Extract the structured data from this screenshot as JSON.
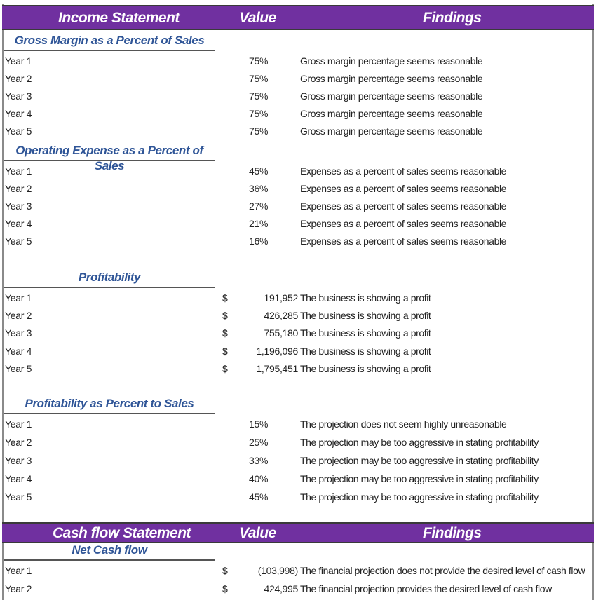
{
  "income_header": {
    "title": "Income Statement",
    "value": "Value",
    "findings": "Findings"
  },
  "gross_margin": {
    "title": "Gross Margin as a Percent of Sales",
    "rows": [
      {
        "label": "Year 1",
        "value": "75%",
        "finding": "Gross margin percentage seems reasonable"
      },
      {
        "label": "Year 2",
        "value": "75%",
        "finding": "Gross margin percentage seems reasonable"
      },
      {
        "label": "Year 3",
        "value": "75%",
        "finding": "Gross margin percentage seems reasonable"
      },
      {
        "label": "Year 4",
        "value": "75%",
        "finding": "Gross margin percentage seems reasonable"
      },
      {
        "label": "Year 5",
        "value": "75%",
        "finding": "Gross margin percentage seems reasonable"
      }
    ]
  },
  "operating_expense": {
    "title": "Operating Expense as a Percent of Sales",
    "rows": [
      {
        "label": "Year 1",
        "value": "45%",
        "finding": "Expenses as a percent of sales seems reasonable"
      },
      {
        "label": "Year 2",
        "value": "36%",
        "finding": "Expenses as a percent of sales seems reasonable"
      },
      {
        "label": "Year 3",
        "value": "27%",
        "finding": "Expenses as a percent of sales seems reasonable"
      },
      {
        "label": "Year 4",
        "value": "21%",
        "finding": "Expenses as a percent of sales seems reasonable"
      },
      {
        "label": "Year 5",
        "value": "16%",
        "finding": "Expenses as a percent of sales seems reasonable"
      }
    ]
  },
  "profitability": {
    "title": "Profitability",
    "currency": "$",
    "rows": [
      {
        "label": "Year 1",
        "value": "191,952",
        "finding": "The business is showing a profit"
      },
      {
        "label": "Year 2",
        "value": "426,285",
        "finding": "The business is showing a profit"
      },
      {
        "label": "Year 3",
        "value": "755,180",
        "finding": "The business is showing a profit"
      },
      {
        "label": "Year 4",
        "value": "1,196,096",
        "finding": "The business is showing a profit"
      },
      {
        "label": "Year 5",
        "value": "1,795,451",
        "finding": "The business is showing a profit"
      }
    ]
  },
  "profitability_pct": {
    "title": "Profitability as Percent to Sales",
    "rows": [
      {
        "label": "Year 1",
        "value": "15%",
        "finding": "The projection does not seem highly unreasonable"
      },
      {
        "label": "Year 2",
        "value": "25%",
        "finding": "The projection may be too aggressive in stating profitability"
      },
      {
        "label": "Year 3",
        "value": "33%",
        "finding": "The projection may be too aggressive in stating profitability"
      },
      {
        "label": "Year 4",
        "value": "40%",
        "finding": "The projection may be too aggressive in stating profitability"
      },
      {
        "label": "Year 5",
        "value": "45%",
        "finding": "The projection may be too aggressive in stating profitability"
      }
    ]
  },
  "cashflow_header": {
    "title": "Cash flow Statement",
    "value": "Value",
    "findings": "Findings"
  },
  "net_cash_flow": {
    "title": "Net Cash flow",
    "currency": "$",
    "rows": [
      {
        "label": "Year 1",
        "value": "(103,998)",
        "finding": "The financial projection does not provide the desired level of cash flow"
      },
      {
        "label": "Year 2",
        "value": "424,995",
        "finding": "The financial projection provides the desired level of cash flow"
      }
    ]
  },
  "colors": {
    "header_bg": "#7030a0",
    "section_title": "#2f5597"
  }
}
